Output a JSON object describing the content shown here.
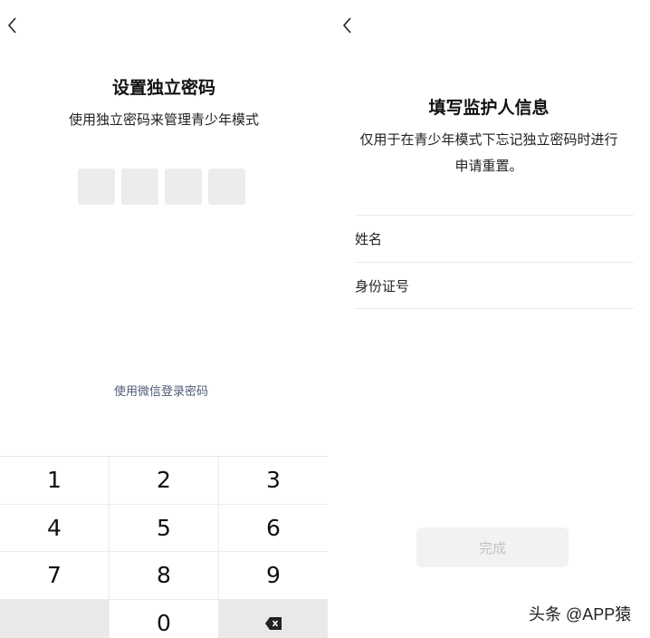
{
  "left": {
    "title": "设置独立密码",
    "subtitle": "使用独立密码来管理青少年模式",
    "wechat_link": "使用微信登录密码",
    "keys": [
      "1",
      "2",
      "3",
      "4",
      "5",
      "6",
      "7",
      "8",
      "9",
      "0"
    ]
  },
  "right": {
    "title": "填写监护人信息",
    "desc_line1": "仅用于在青少年模式下忘记独立密码时进行",
    "desc_line2": "申请重置。",
    "name_label": "姓名",
    "id_label": "身份证号",
    "done_label": "完成",
    "watermark": "头条 @APP猿"
  },
  "icons": {
    "back": "chevron-left-icon",
    "delete": "backspace-icon"
  },
  "colors": {
    "link": "#4e5a78",
    "disabled_button_bg": "#f2f2f2",
    "disabled_button_text": "#c2c2c2",
    "pin_box": "#ececec"
  }
}
